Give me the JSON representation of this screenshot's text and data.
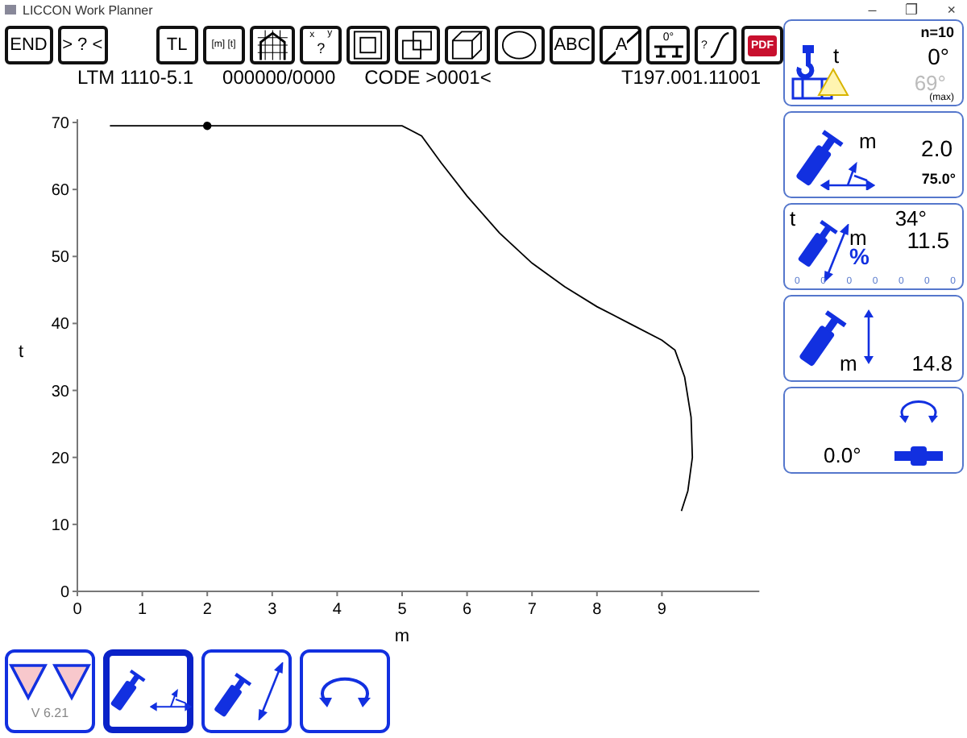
{
  "window": {
    "title": "LICCON Work Planner",
    "controls": [
      "–",
      "❐",
      "×"
    ]
  },
  "toolbar": [
    {
      "kind": "text",
      "label": "END"
    },
    {
      "kind": "text",
      "label": "> ? <"
    },
    {
      "kind": "spacer"
    },
    {
      "kind": "text",
      "label": "TL"
    },
    {
      "kind": "small",
      "label": "[m] [t]"
    },
    {
      "kind": "house"
    },
    {
      "kind": "axes",
      "x_label": "x",
      "y_label": "y",
      "mark": "?"
    },
    {
      "kind": "frame"
    },
    {
      "kind": "overlap"
    },
    {
      "kind": "cube"
    },
    {
      "kind": "ellipse"
    },
    {
      "kind": "text",
      "label": "ABC"
    },
    {
      "kind": "crossed",
      "label": "A"
    },
    {
      "kind": "level",
      "label": "0°"
    },
    {
      "kind": "curve",
      "label": "?"
    },
    {
      "kind": "pdf",
      "label": "PDF"
    }
  ],
  "header": [
    "LTM 1110-5.1",
    "000000/0000",
    "CODE >0001<",
    "T197.001.11001"
  ],
  "chart": {
    "chart_data": {
      "type": "line",
      "xlabel": "m",
      "ylabel": "t",
      "x": [
        0.5,
        2.0,
        5.0,
        5.3,
        5.6,
        6.0,
        6.5,
        7.0,
        7.5,
        8.0,
        8.5,
        9.0,
        9.2,
        9.35,
        9.45,
        9.47,
        9.4,
        9.3
      ],
      "series": [
        {
          "color": "#000000",
          "values": [
            69.5,
            69.5,
            69.5,
            68,
            64,
            59,
            53.5,
            49,
            45.5,
            42.5,
            40,
            37.5,
            36,
            32,
            26,
            20,
            15,
            12
          ]
        },
        {
          "color": "#000000",
          "marker": "circle",
          "values": [
            null,
            69.5,
            null,
            null,
            null,
            null,
            null,
            null,
            null,
            null,
            null,
            null,
            null,
            null,
            null,
            null,
            null,
            null
          ]
        }
      ],
      "xlim": [
        0,
        10.5
      ],
      "ylim": [
        0,
        70
      ],
      "xticks": [
        0,
        1,
        2,
        3,
        4,
        5,
        6,
        7,
        8,
        9
      ],
      "yticks": [
        0,
        10,
        20,
        30,
        40,
        50,
        60,
        70
      ]
    }
  },
  "panel": [
    {
      "kind": "load",
      "count": "n=10",
      "unit": "t",
      "value": "0°",
      "max_value": "69°",
      "max_label": "(max)"
    },
    {
      "kind": "radius",
      "unit": "m",
      "value": "2.0",
      "angle": "75.0°"
    },
    {
      "kind": "boom",
      "unit_top": "t",
      "value_top": "34°",
      "unit": "m",
      "value": "11.5",
      "percent": "%",
      "scale": [
        "0",
        "0",
        "0",
        "0",
        "0",
        "0",
        "0"
      ]
    },
    {
      "kind": "height",
      "unit": "m",
      "value": "14.8"
    },
    {
      "kind": "slew",
      "value": "0.0°"
    }
  ],
  "bottom": {
    "version": "V 6.21",
    "buttons": [
      {
        "kind": "radius",
        "selected": true
      },
      {
        "kind": "boom",
        "selected": false
      },
      {
        "kind": "slew",
        "selected": false
      }
    ]
  }
}
